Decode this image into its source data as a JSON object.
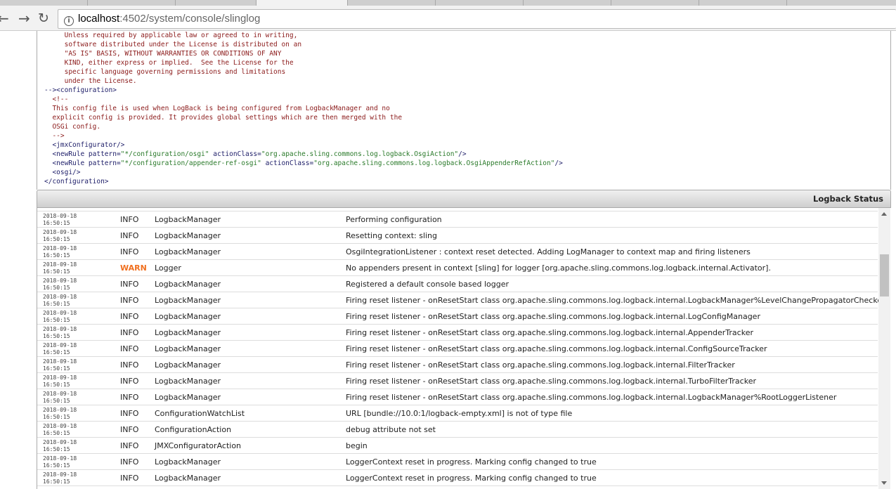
{
  "browser": {
    "url_host": "localhost",
    "url_rest": ":4502/system/console/slinglog"
  },
  "config_lines": [
    {
      "cls": "cm",
      "text": "     Unless required by applicable law or agreed to in writing,"
    },
    {
      "cls": "cm",
      "text": "     software distributed under the License is distributed on an"
    },
    {
      "cls": "cm",
      "text": "     \"AS IS\" BASIS, WITHOUT WARRANTIES OR CONDITIONS OF ANY"
    },
    {
      "cls": "cm",
      "text": "     KIND, either express or implied.  See the License for the"
    },
    {
      "cls": "cm",
      "text": "     specific language governing permissions and limitations"
    },
    {
      "cls": "cm",
      "text": "     under the License."
    },
    {
      "cls": "tg",
      "text": "--><configuration>"
    },
    {
      "cls": "cm",
      "text": "  <!--"
    },
    {
      "cls": "cm",
      "text": "  This config file is used when LogBack is being configured from LogbackManager and no"
    },
    {
      "cls": "cm",
      "text": "  explicit config is provided. It provides global settings which are then merged with the"
    },
    {
      "cls": "cm",
      "text": "  OSGi config."
    },
    {
      "cls": "cm",
      "text": "  -->"
    },
    {
      "cls": "tg",
      "text": "  <jmxConfigurator/>"
    },
    {
      "cls": "tg",
      "text": "  <newRule pattern=\"*/configuration/osgi\" actionClass=\"org.apache.sling.commons.log.logback.OsgiAction\"/>"
    },
    {
      "cls": "tg",
      "text": "  <newRule pattern=\"*/configuration/appender-ref-osgi\" actionClass=\"org.apache.sling.commons.log.logback.OsgiAppenderRefAction\"/>"
    },
    {
      "cls": "tg",
      "text": "  <osgi/>"
    },
    {
      "cls": "tg",
      "text": "</configuration>"
    }
  ],
  "status_title": "Logback Status",
  "colors": {
    "warn": "#f07020"
  },
  "log_rows": [
    {
      "date": "",
      "time": "16:50:15",
      "level": "",
      "logger": "",
      "message": ""
    },
    {
      "date": "2018-09-18",
      "time": "16:50:15",
      "level": "INFO",
      "logger": "LogbackManager",
      "message": "Performing configuration"
    },
    {
      "date": "2018-09-18",
      "time": "16:50:15",
      "level": "INFO",
      "logger": "LogbackManager",
      "message": "Resetting context: sling"
    },
    {
      "date": "2018-09-18",
      "time": "16:50:15",
      "level": "INFO",
      "logger": "LogbackManager",
      "message": "OsgiIntegrationListener : context reset detected. Adding LogManager to context map and firing listeners"
    },
    {
      "date": "2018-09-18",
      "time": "16:50:15",
      "level": "WARN",
      "logger": "Logger",
      "message": "No appenders present in context [sling] for logger [org.apache.sling.commons.log.logback.internal.Activator]."
    },
    {
      "date": "2018-09-18",
      "time": "16:50:15",
      "level": "INFO",
      "logger": "LogbackManager",
      "message": "Registered a default console based logger"
    },
    {
      "date": "2018-09-18",
      "time": "16:50:15",
      "level": "INFO",
      "logger": "LogbackManager",
      "message": "Firing reset listener - onResetStart class org.apache.sling.commons.log.logback.internal.LogbackManager%LevelChangePropagatorChecker"
    },
    {
      "date": "2018-09-18",
      "time": "16:50:15",
      "level": "INFO",
      "logger": "LogbackManager",
      "message": "Firing reset listener - onResetStart class org.apache.sling.commons.log.logback.internal.LogConfigManager"
    },
    {
      "date": "2018-09-18",
      "time": "16:50:15",
      "level": "INFO",
      "logger": "LogbackManager",
      "message": "Firing reset listener - onResetStart class org.apache.sling.commons.log.logback.internal.AppenderTracker"
    },
    {
      "date": "2018-09-18",
      "time": "16:50:15",
      "level": "INFO",
      "logger": "LogbackManager",
      "message": "Firing reset listener - onResetStart class org.apache.sling.commons.log.logback.internal.ConfigSourceTracker"
    },
    {
      "date": "2018-09-18",
      "time": "16:50:15",
      "level": "INFO",
      "logger": "LogbackManager",
      "message": "Firing reset listener - onResetStart class org.apache.sling.commons.log.logback.internal.FilterTracker"
    },
    {
      "date": "2018-09-18",
      "time": "16:50:15",
      "level": "INFO",
      "logger": "LogbackManager",
      "message": "Firing reset listener - onResetStart class org.apache.sling.commons.log.logback.internal.TurboFilterTracker"
    },
    {
      "date": "2018-09-18",
      "time": "16:50:15",
      "level": "INFO",
      "logger": "LogbackManager",
      "message": "Firing reset listener - onResetStart class org.apache.sling.commons.log.logback.internal.LogbackManager%RootLoggerListener"
    },
    {
      "date": "2018-09-18",
      "time": "16:50:15",
      "level": "INFO",
      "logger": "ConfigurationWatchList",
      "message": "URL [bundle://10.0:1/logback-empty.xml] is not of type file"
    },
    {
      "date": "2018-09-18",
      "time": "16:50:15",
      "level": "INFO",
      "logger": "ConfigurationAction",
      "message": "debug attribute not set"
    },
    {
      "date": "2018-09-18",
      "time": "16:50:15",
      "level": "INFO",
      "logger": "JMXConfiguratorAction",
      "message": "begin"
    },
    {
      "date": "2018-09-18",
      "time": "16:50:15",
      "level": "INFO",
      "logger": "LogbackManager",
      "message": "LoggerContext reset in progress. Marking config changed to true"
    },
    {
      "date": "2018-09-18",
      "time": "16:50:15",
      "level": "INFO",
      "logger": "LogbackManager",
      "message": "LoggerContext reset in progress. Marking config changed to true"
    }
  ]
}
